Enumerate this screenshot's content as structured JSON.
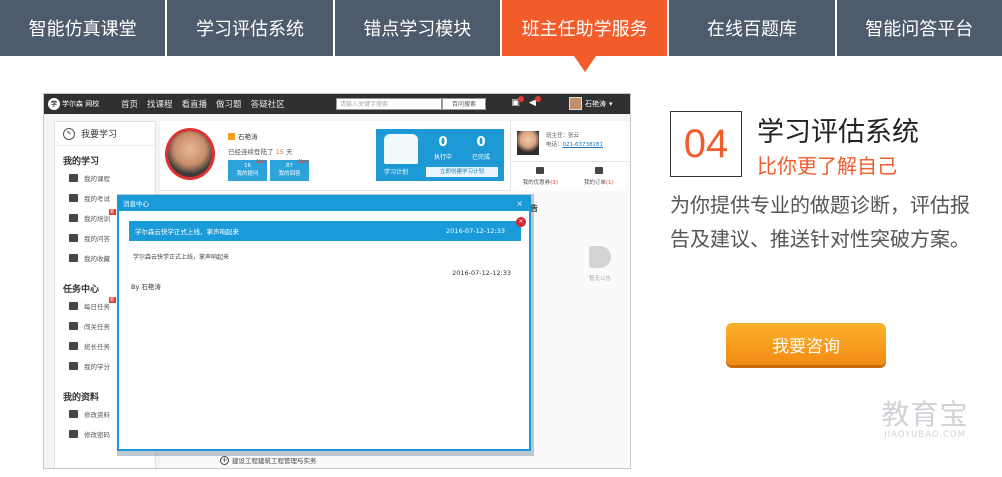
{
  "tabs": [
    {
      "label": "智能仿真课堂"
    },
    {
      "label": "学习评估系统"
    },
    {
      "label": "错点学习模块"
    },
    {
      "label": "班主任助学服务"
    },
    {
      "label": "在线百题库"
    },
    {
      "label": "智能问答平台"
    }
  ],
  "active_tab_index": 3,
  "screenshot": {
    "logo": {
      "text": "学尔森 网校",
      "url_text": "www.xueersen.com"
    },
    "nav": [
      "首页",
      "找课程",
      "看直播",
      "做习题",
      "答疑社区"
    ],
    "search": {
      "placeholder": "请输入关键字搜索",
      "button": "百问搜索"
    },
    "user_name": "石艳涛",
    "sidebar": {
      "header": "我要学习",
      "sections": [
        {
          "title": "我的学习",
          "items": [
            "我的课程",
            "我的考试",
            "我的培训",
            "我的问答",
            "我的收藏"
          ]
        },
        {
          "title": "任务中心",
          "items": [
            "每日任务",
            "闯关任务",
            "班长任务",
            "我的学分"
          ]
        },
        {
          "title": "我的资料",
          "items": [
            "修改资料",
            "修改密码"
          ]
        }
      ],
      "new_badge": "新"
    },
    "profile": {
      "name": "石艳涛",
      "login_prefix": "已经连续登陆了",
      "login_days": "15",
      "login_suffix": "天",
      "stats": [
        {
          "count": "16",
          "label": "我的提问",
          "new": "New"
        },
        {
          "count": "87",
          "label": "我的回答",
          "new": "New"
        }
      ]
    },
    "plan": {
      "label": "学习计划",
      "in_progress_num": "0",
      "in_progress_label": "执行中",
      "done_num": "0",
      "done_label": "已完成",
      "create_button": "立即创建学习计划"
    },
    "tutor": {
      "title_label": "班主任：张云",
      "phone_label": "电话：",
      "phone": "021-63738281",
      "coupons_label": "我的优惠券",
      "coupons_count": "(3)",
      "orders_label": "我的订单",
      "orders_count": "(1)"
    },
    "notice_title": "最新公告",
    "notice_empty": "暂无公告",
    "bottom_link": "建设工程建筑工程管理与实务",
    "modal": {
      "title": "消息中心",
      "close": "×",
      "message_title": "学尔森云快学正式上线，掌声响起来",
      "message_date": "2016-07-12-12:33",
      "message_body": "学尔森云快学正式上线，掌声响起来",
      "message_body_date": "2016-07-12-12:33",
      "by": "By 石艳涛"
    }
  },
  "promo": {
    "number": "04",
    "title": "学习评估系统",
    "subtitle": "比你更了解自己",
    "description": "为你提供专业的做题诊断，评估报告及建议、推送针对性突破方案。",
    "cta": "我要咨询"
  },
  "watermark": {
    "title": "教育宝",
    "subtitle": "JIAOYUBAO.COM"
  },
  "colors": {
    "tab_bg": "#4d5b6c",
    "tab_active": "#f25c2a",
    "accent_blue": "#1a9ad8",
    "cta_orange": "#f7a21f"
  }
}
